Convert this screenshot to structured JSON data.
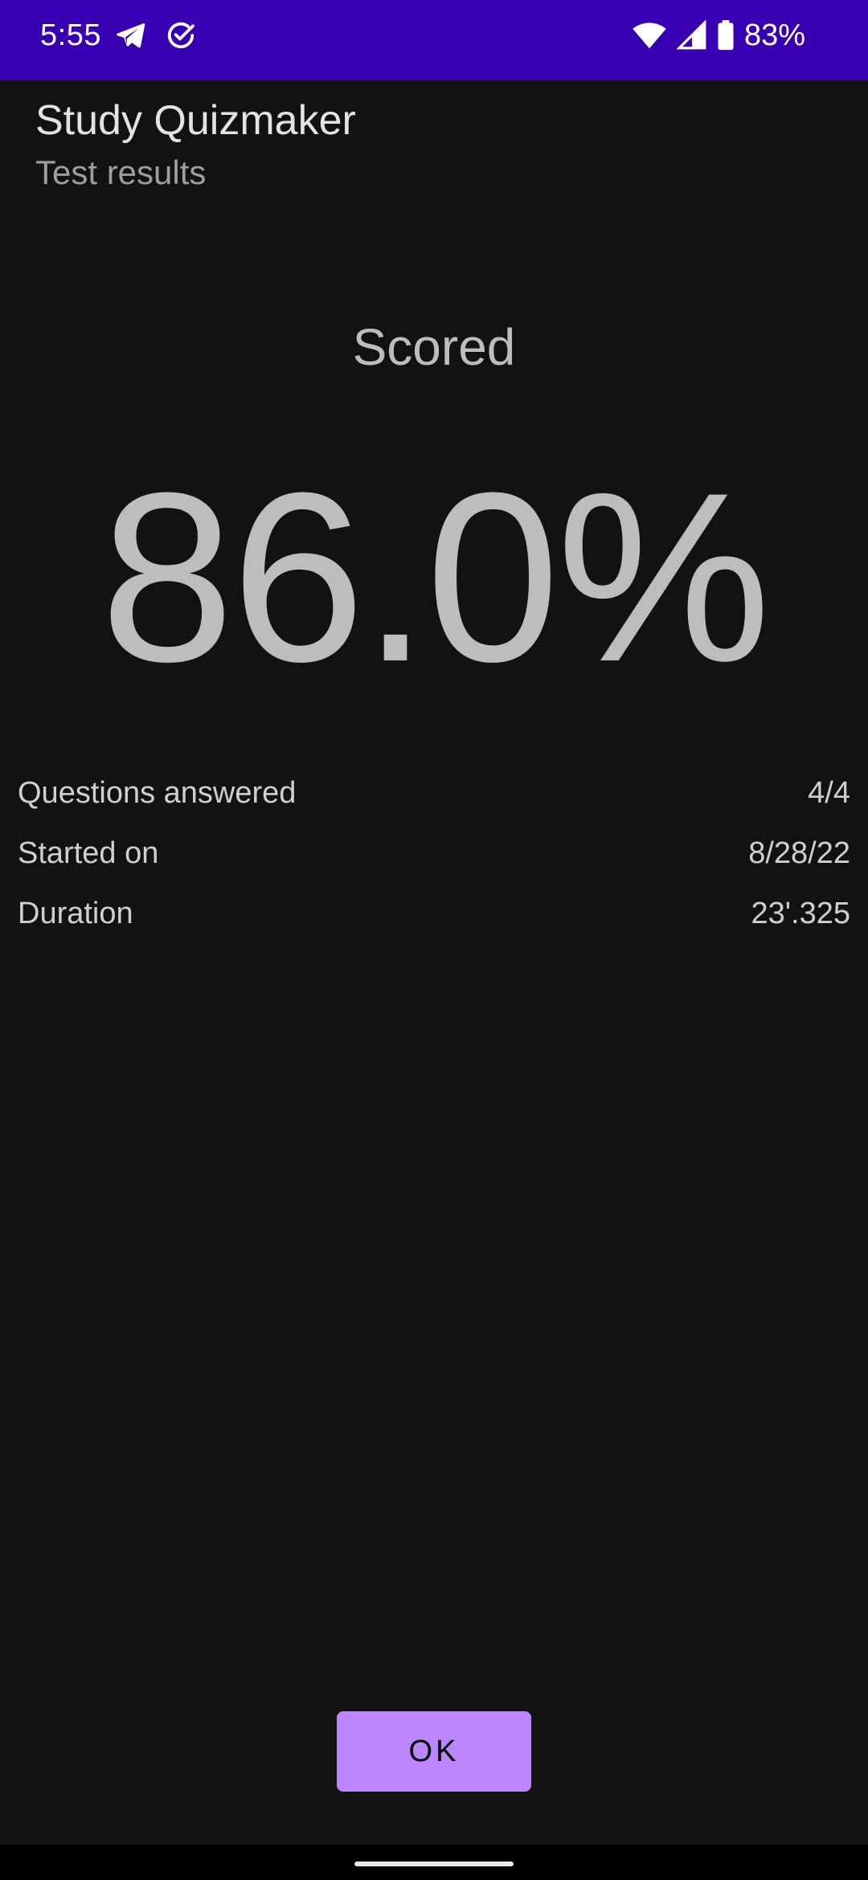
{
  "status_bar": {
    "time": "5:55",
    "battery_percent": "83%",
    "icons": [
      "telegram-icon",
      "check-circle-icon",
      "wifi-icon",
      "cell-signal-icon",
      "battery-icon"
    ],
    "background_color": "#3700b3"
  },
  "app_bar": {
    "title": "Study Quizmaker",
    "subtitle": "Test results"
  },
  "score": {
    "label": "Scored",
    "value": "86.0%"
  },
  "details": {
    "rows": [
      {
        "label": "Questions answered",
        "value": "4/4"
      },
      {
        "label": "Started on",
        "value": "8/28/22"
      },
      {
        "label": "Duration",
        "value": "23'.325"
      }
    ]
  },
  "actions": {
    "ok_label": "OK",
    "accent_color": "#bb86fc"
  }
}
